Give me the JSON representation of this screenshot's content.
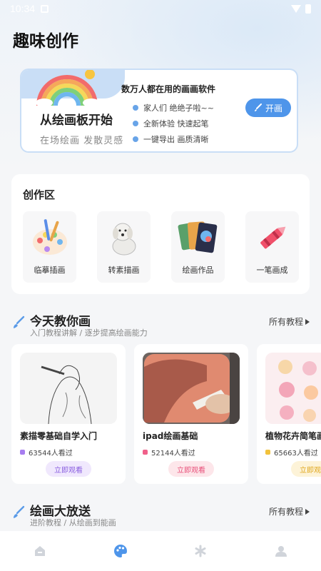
{
  "status": {
    "time": "10:34"
  },
  "app": {
    "title": "趣味创作"
  },
  "banner": {
    "main_title": "从绘画板开始",
    "subtitle": "在场绘画  发散灵感",
    "heading": "数万人都在用的画画软件",
    "features": [
      "家人们  绝绝子啦~~",
      "全新体验  快速起笔",
      "一键导出  画质清晰"
    ],
    "button_label": "开画"
  },
  "creation": {
    "title": "创作区",
    "tools": [
      {
        "label": "临摹插画",
        "icon": "palette-icon"
      },
      {
        "label": "转素描画",
        "icon": "puppy-sketch-icon"
      },
      {
        "label": "绘画作品",
        "icon": "artwork-cards-icon"
      },
      {
        "label": "一笔画成",
        "icon": "crayon-icon"
      }
    ]
  },
  "today": {
    "title": "今天教你画",
    "subtitle": "入门教程讲解 / 逐步提高绘画能力",
    "more": "所有教程",
    "lessons": [
      {
        "title": "素描零基础自学入门",
        "views": "63544人看过",
        "button": "立即观看",
        "accent": "#a77df0",
        "btn_bg": "#f0e8fd",
        "btn_fg": "#8a5fe0"
      },
      {
        "title": "ipad绘画基础",
        "views": "52144人看过",
        "button": "立即观看",
        "accent": "#f0608a",
        "btn_bg": "#fde6ea",
        "btn_fg": "#e8507a"
      },
      {
        "title": "植物花卉简笔画",
        "views": "65663人看过",
        "button": "立即观看",
        "accent": "#f2c23c",
        "btn_bg": "#fdf3d8",
        "btn_fg": "#e0a820"
      }
    ]
  },
  "advanced": {
    "title": "绘画大放送",
    "subtitle": "进阶教程 / 从绘画到能画",
    "more": "所有教程"
  },
  "nav": [
    {
      "icon": "home-icon",
      "active": false
    },
    {
      "icon": "palette-icon",
      "active": true
    },
    {
      "icon": "asterisk-icon",
      "active": false
    },
    {
      "icon": "user-icon",
      "active": false
    }
  ],
  "colors": {
    "accent": "#4e95ea",
    "banner_frame": "#c9def6",
    "inactive_nav": "#d0d4da"
  }
}
